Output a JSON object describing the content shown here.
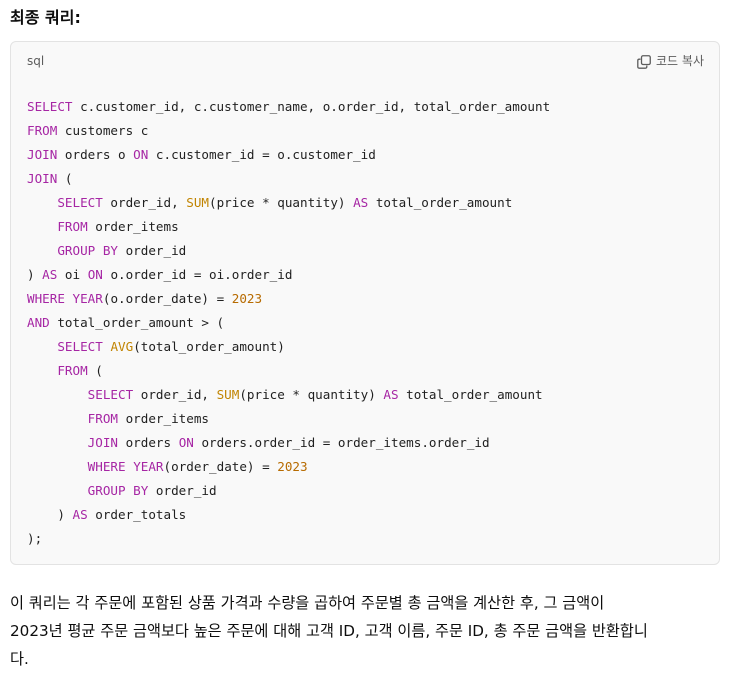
{
  "heading": "최종 쿼리:",
  "code_block": {
    "language": "sql",
    "copy_label": "코드 복사",
    "copy_icon": "copy-icon",
    "lines": [
      [
        {
          "t": "k",
          "v": "SELECT"
        },
        {
          "t": "p",
          "v": " c.customer_id, c.customer_name, o.order_id, total_order_amount"
        }
      ],
      [
        {
          "t": "k",
          "v": "FROM"
        },
        {
          "t": "p",
          "v": " customers c"
        }
      ],
      [
        {
          "t": "k",
          "v": "JOIN"
        },
        {
          "t": "p",
          "v": " orders o "
        },
        {
          "t": "k",
          "v": "ON"
        },
        {
          "t": "p",
          "v": " c.customer_id = o.customer_id"
        }
      ],
      [
        {
          "t": "k",
          "v": "JOIN"
        },
        {
          "t": "p",
          "v": " ("
        }
      ],
      [
        {
          "t": "p",
          "v": "    "
        },
        {
          "t": "k",
          "v": "SELECT"
        },
        {
          "t": "p",
          "v": " order_id, "
        },
        {
          "t": "f",
          "v": "SUM"
        },
        {
          "t": "p",
          "v": "(price * quantity) "
        },
        {
          "t": "k",
          "v": "AS"
        },
        {
          "t": "p",
          "v": " total_order_amount"
        }
      ],
      [
        {
          "t": "p",
          "v": "    "
        },
        {
          "t": "k",
          "v": "FROM"
        },
        {
          "t": "p",
          "v": " order_items"
        }
      ],
      [
        {
          "t": "p",
          "v": "    "
        },
        {
          "t": "k",
          "v": "GROUP BY"
        },
        {
          "t": "p",
          "v": " order_id"
        }
      ],
      [
        {
          "t": "p",
          "v": ") "
        },
        {
          "t": "k",
          "v": "AS"
        },
        {
          "t": "p",
          "v": " oi "
        },
        {
          "t": "k",
          "v": "ON"
        },
        {
          "t": "p",
          "v": " o.order_id = oi.order_id"
        }
      ],
      [
        {
          "t": "k",
          "v": "WHERE"
        },
        {
          "t": "p",
          "v": " "
        },
        {
          "t": "k",
          "v": "YEAR"
        },
        {
          "t": "p",
          "v": "(o.order_date) = "
        },
        {
          "t": "n",
          "v": "2023"
        }
      ],
      [
        {
          "t": "k",
          "v": "AND"
        },
        {
          "t": "p",
          "v": " total_order_amount > ("
        }
      ],
      [
        {
          "t": "p",
          "v": "    "
        },
        {
          "t": "k",
          "v": "SELECT"
        },
        {
          "t": "p",
          "v": " "
        },
        {
          "t": "f",
          "v": "AVG"
        },
        {
          "t": "p",
          "v": "(total_order_amount)"
        }
      ],
      [
        {
          "t": "p",
          "v": "    "
        },
        {
          "t": "k",
          "v": "FROM"
        },
        {
          "t": "p",
          "v": " ("
        }
      ],
      [
        {
          "t": "p",
          "v": "        "
        },
        {
          "t": "k",
          "v": "SELECT"
        },
        {
          "t": "p",
          "v": " order_id, "
        },
        {
          "t": "f",
          "v": "SUM"
        },
        {
          "t": "p",
          "v": "(price * quantity) "
        },
        {
          "t": "k",
          "v": "AS"
        },
        {
          "t": "p",
          "v": " total_order_amount"
        }
      ],
      [
        {
          "t": "p",
          "v": "        "
        },
        {
          "t": "k",
          "v": "FROM"
        },
        {
          "t": "p",
          "v": " order_items"
        }
      ],
      [
        {
          "t": "p",
          "v": "        "
        },
        {
          "t": "k",
          "v": "JOIN"
        },
        {
          "t": "p",
          "v": " orders "
        },
        {
          "t": "k",
          "v": "ON"
        },
        {
          "t": "p",
          "v": " orders.order_id = order_items.order_id"
        }
      ],
      [
        {
          "t": "p",
          "v": "        "
        },
        {
          "t": "k",
          "v": "WHERE"
        },
        {
          "t": "p",
          "v": " "
        },
        {
          "t": "k",
          "v": "YEAR"
        },
        {
          "t": "p",
          "v": "(order_date) = "
        },
        {
          "t": "n",
          "v": "2023"
        }
      ],
      [
        {
          "t": "p",
          "v": "        "
        },
        {
          "t": "k",
          "v": "GROUP BY"
        },
        {
          "t": "p",
          "v": " order_id"
        }
      ],
      [
        {
          "t": "p",
          "v": "    ) "
        },
        {
          "t": "k",
          "v": "AS"
        },
        {
          "t": "p",
          "v": " order_totals"
        }
      ],
      [
        {
          "t": "p",
          "v": ");"
        }
      ]
    ]
  },
  "explanation": {
    "lines": [
      "이 쿼리는 각 주문에 포함된 상품 가격과 수량을 곱하여 주문별 총 금액을 계산한 후, 그 금액이",
      "2023년 평균 주문 금액보다 높은 주문에 대해 고객 ID, 고객 이름, 주문 ID, 총 주문 금액을 반환합니",
      "다."
    ]
  },
  "colors": {
    "keyword": "#a626a4",
    "function": "#c18401",
    "number": "#b76b01",
    "code_background": "#f9f9f9",
    "code_border": "#e3e3e3"
  }
}
